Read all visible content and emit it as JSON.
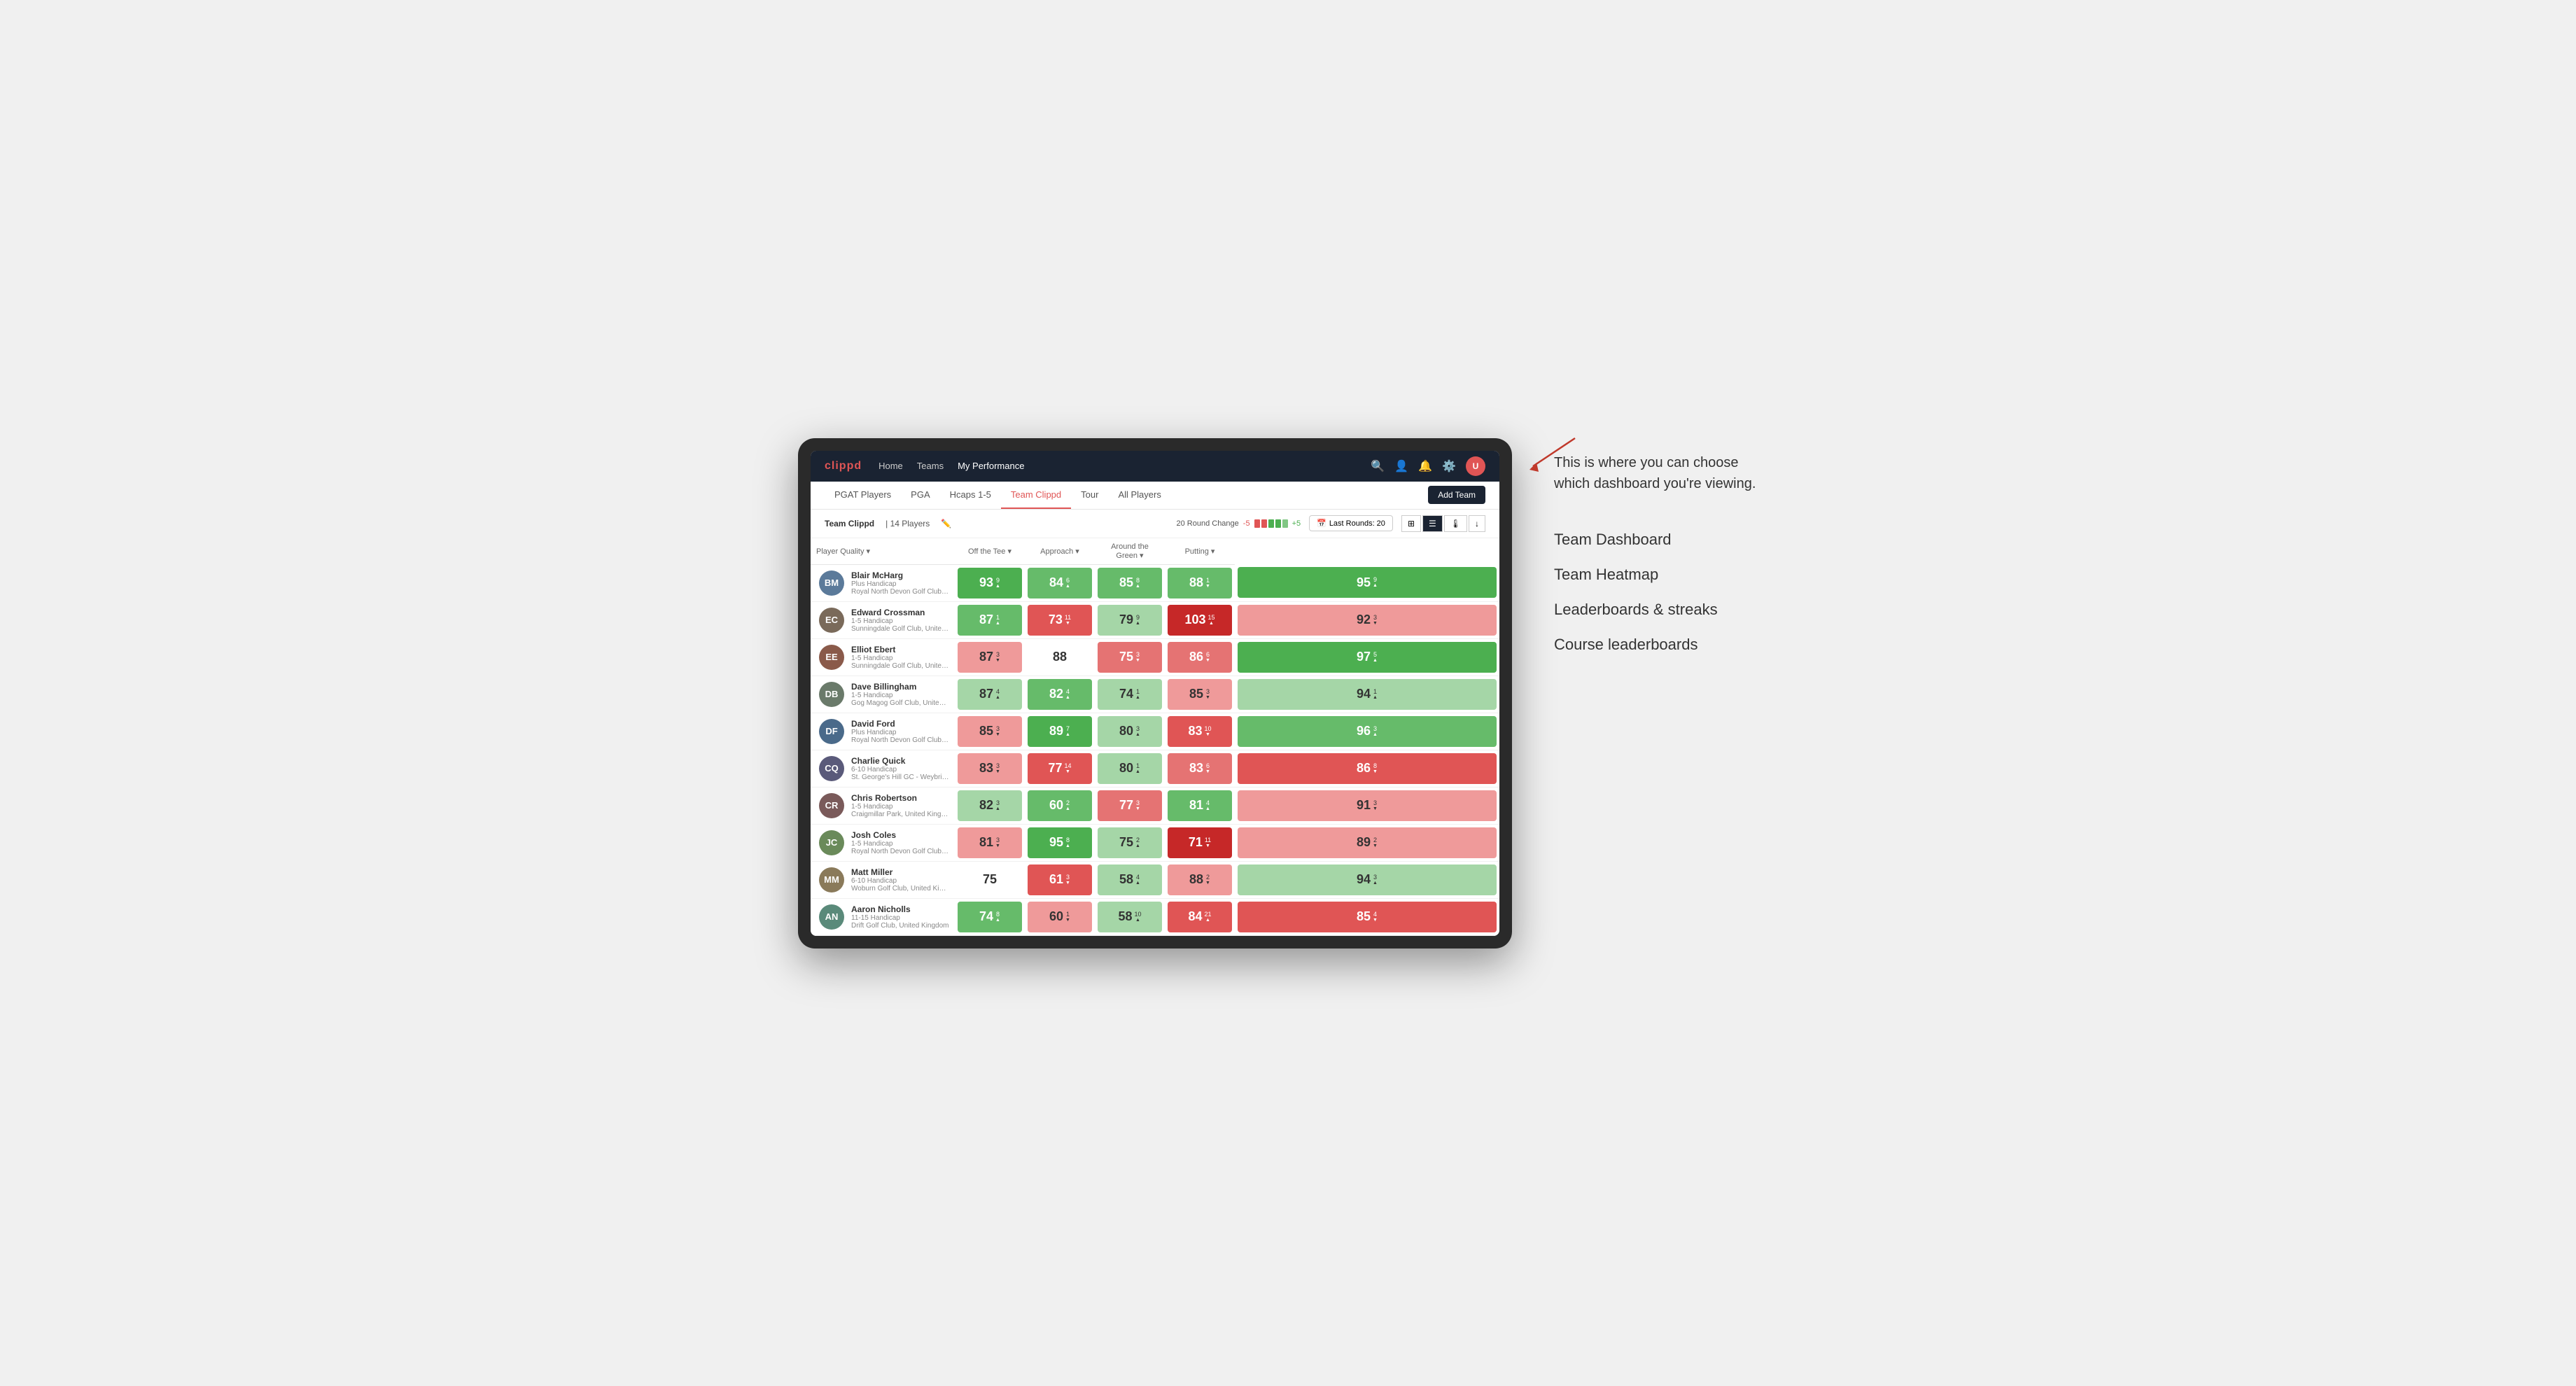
{
  "annotation": {
    "intro_text": "This is where you can choose which dashboard you're viewing.",
    "menu_items": [
      "Team Dashboard",
      "Team Heatmap",
      "Leaderboards & streaks",
      "Course leaderboards"
    ]
  },
  "nav": {
    "logo": "clippd",
    "links": [
      "Home",
      "Teams",
      "My Performance"
    ],
    "sub_links": [
      "PGAT Players",
      "PGA",
      "Hcaps 1-5",
      "Team Clippd",
      "Tour",
      "All Players"
    ],
    "active_sub": "Team Clippd",
    "add_team_label": "Add Team"
  },
  "team_header": {
    "team_name": "Team Clippd",
    "player_count": "14 Players",
    "round_change_label": "20 Round Change",
    "minus": "-5",
    "plus": "+5",
    "last_rounds_label": "Last Rounds:",
    "last_rounds_value": "20"
  },
  "table": {
    "columns": [
      "Player Quality ▾",
      "Off the Tee ▾",
      "Approach ▾",
      "Around the Green ▾",
      "Putting ▾"
    ],
    "rows": [
      {
        "name": "Blair McHarg",
        "handicap": "Plus Handicap",
        "club": "Royal North Devon Golf Club, United Kingdom",
        "avatar_color": "#5b7a9a",
        "initials": "BM",
        "metrics": [
          {
            "value": "93",
            "change": "9",
            "dir": "up",
            "color": "green-dark"
          },
          {
            "value": "84",
            "change": "6",
            "dir": "up",
            "color": "green-mid"
          },
          {
            "value": "85",
            "change": "8",
            "dir": "up",
            "color": "green-mid"
          },
          {
            "value": "88",
            "change": "1",
            "dir": "down",
            "color": "green-mid"
          },
          {
            "value": "95",
            "change": "9",
            "dir": "up",
            "color": "green-dark"
          }
        ]
      },
      {
        "name": "Edward Crossman",
        "handicap": "1-5 Handicap",
        "club": "Sunningdale Golf Club, United Kingdom",
        "avatar_color": "#7a6a5a",
        "initials": "EC",
        "metrics": [
          {
            "value": "87",
            "change": "1",
            "dir": "up",
            "color": "green-mid"
          },
          {
            "value": "73",
            "change": "11",
            "dir": "down",
            "color": "red-dark"
          },
          {
            "value": "79",
            "change": "9",
            "dir": "up",
            "color": "green-light"
          },
          {
            "value": "103",
            "change": "15",
            "dir": "up",
            "color": "red-deep"
          },
          {
            "value": "92",
            "change": "3",
            "dir": "down",
            "color": "red-light"
          }
        ]
      },
      {
        "name": "Elliot Ebert",
        "handicap": "1-5 Handicap",
        "club": "Sunningdale Golf Club, United Kingdom",
        "avatar_color": "#8a5a4a",
        "initials": "EE",
        "metrics": [
          {
            "value": "87",
            "change": "3",
            "dir": "down",
            "color": "red-light"
          },
          {
            "value": "88",
            "change": "",
            "dir": "",
            "color": "white-bg"
          },
          {
            "value": "75",
            "change": "3",
            "dir": "down",
            "color": "red-mid"
          },
          {
            "value": "86",
            "change": "6",
            "dir": "down",
            "color": "red-mid"
          },
          {
            "value": "97",
            "change": "5",
            "dir": "up",
            "color": "green-dark"
          }
        ]
      },
      {
        "name": "Dave Billingham",
        "handicap": "1-5 Handicap",
        "club": "Gog Magog Golf Club, United Kingdom",
        "avatar_color": "#6a7a6a",
        "initials": "DB",
        "metrics": [
          {
            "value": "87",
            "change": "4",
            "dir": "up",
            "color": "green-light"
          },
          {
            "value": "82",
            "change": "4",
            "dir": "up",
            "color": "green-mid"
          },
          {
            "value": "74",
            "change": "1",
            "dir": "up",
            "color": "green-light"
          },
          {
            "value": "85",
            "change": "3",
            "dir": "down",
            "color": "red-light"
          },
          {
            "value": "94",
            "change": "1",
            "dir": "up",
            "color": "green-light"
          }
        ]
      },
      {
        "name": "David Ford",
        "handicap": "Plus Handicap",
        "club": "Royal North Devon Golf Club, United Kingdom",
        "avatar_color": "#4a6a8a",
        "initials": "DF",
        "metrics": [
          {
            "value": "85",
            "change": "3",
            "dir": "down",
            "color": "red-light"
          },
          {
            "value": "89",
            "change": "7",
            "dir": "up",
            "color": "green-dark"
          },
          {
            "value": "80",
            "change": "3",
            "dir": "up",
            "color": "green-light"
          },
          {
            "value": "83",
            "change": "10",
            "dir": "down",
            "color": "red-dark"
          },
          {
            "value": "96",
            "change": "3",
            "dir": "up",
            "color": "green-mid"
          }
        ]
      },
      {
        "name": "Charlie Quick",
        "handicap": "6-10 Handicap",
        "club": "St. George's Hill GC - Weybridge - Surrey, Uni...",
        "avatar_color": "#5a5a7a",
        "initials": "CQ",
        "metrics": [
          {
            "value": "83",
            "change": "3",
            "dir": "down",
            "color": "red-light"
          },
          {
            "value": "77",
            "change": "14",
            "dir": "down",
            "color": "red-dark"
          },
          {
            "value": "80",
            "change": "1",
            "dir": "up",
            "color": "green-light"
          },
          {
            "value": "83",
            "change": "6",
            "dir": "down",
            "color": "red-mid"
          },
          {
            "value": "86",
            "change": "8",
            "dir": "down",
            "color": "red-dark"
          }
        ]
      },
      {
        "name": "Chris Robertson",
        "handicap": "1-5 Handicap",
        "club": "Craigmillar Park, United Kingdom",
        "avatar_color": "#7a5a5a",
        "initials": "CR",
        "metrics": [
          {
            "value": "82",
            "change": "3",
            "dir": "up",
            "color": "green-light"
          },
          {
            "value": "60",
            "change": "2",
            "dir": "up",
            "color": "green-mid"
          },
          {
            "value": "77",
            "change": "3",
            "dir": "down",
            "color": "red-mid"
          },
          {
            "value": "81",
            "change": "4",
            "dir": "up",
            "color": "green-mid"
          },
          {
            "value": "91",
            "change": "3",
            "dir": "down",
            "color": "red-light"
          }
        ]
      },
      {
        "name": "Josh Coles",
        "handicap": "1-5 Handicap",
        "club": "Royal North Devon Golf Club, United Kingdom",
        "avatar_color": "#6a8a5a",
        "initials": "JC",
        "metrics": [
          {
            "value": "81",
            "change": "3",
            "dir": "down",
            "color": "red-light"
          },
          {
            "value": "95",
            "change": "8",
            "dir": "up",
            "color": "green-dark"
          },
          {
            "value": "75",
            "change": "2",
            "dir": "up",
            "color": "green-light"
          },
          {
            "value": "71",
            "change": "11",
            "dir": "down",
            "color": "red-deep"
          },
          {
            "value": "89",
            "change": "2",
            "dir": "down",
            "color": "red-light"
          }
        ]
      },
      {
        "name": "Matt Miller",
        "handicap": "6-10 Handicap",
        "club": "Woburn Golf Club, United Kingdom",
        "avatar_color": "#8a7a5a",
        "initials": "MM",
        "metrics": [
          {
            "value": "75",
            "change": "",
            "dir": "",
            "color": "white-bg"
          },
          {
            "value": "61",
            "change": "3",
            "dir": "down",
            "color": "red-dark"
          },
          {
            "value": "58",
            "change": "4",
            "dir": "up",
            "color": "green-light"
          },
          {
            "value": "88",
            "change": "2",
            "dir": "down",
            "color": "red-light"
          },
          {
            "value": "94",
            "change": "3",
            "dir": "up",
            "color": "green-light"
          }
        ]
      },
      {
        "name": "Aaron Nicholls",
        "handicap": "11-15 Handicap",
        "club": "Drift Golf Club, United Kingdom",
        "avatar_color": "#5a8a7a",
        "initials": "AN",
        "metrics": [
          {
            "value": "74",
            "change": "8",
            "dir": "up",
            "color": "green-mid"
          },
          {
            "value": "60",
            "change": "1",
            "dir": "down",
            "color": "red-light"
          },
          {
            "value": "58",
            "change": "10",
            "dir": "up",
            "color": "green-light"
          },
          {
            "value": "84",
            "change": "21",
            "dir": "up",
            "color": "red-dark"
          },
          {
            "value": "85",
            "change": "4",
            "dir": "down",
            "color": "red-dark"
          }
        ]
      }
    ]
  }
}
